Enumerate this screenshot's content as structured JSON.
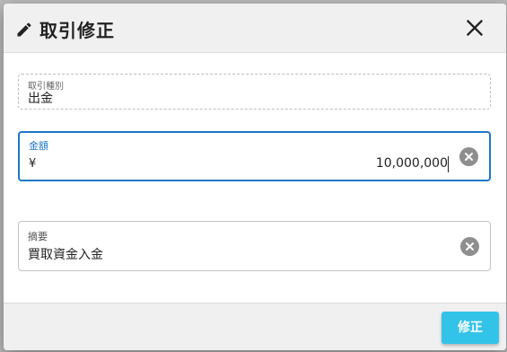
{
  "dialog": {
    "title": "取引修正",
    "title_icon": "pencil-icon",
    "close_icon": "close-icon"
  },
  "fields": {
    "transaction_type": {
      "label": "取引種別",
      "value": "出金"
    },
    "amount": {
      "label": "金額",
      "prefix": "¥",
      "value": "10,000,000"
    },
    "memo": {
      "label": "摘要",
      "value": "買取資金入金"
    }
  },
  "footer": {
    "submit_label": "修正"
  },
  "colors": {
    "accent": "#1e77c7",
    "submit_button": "#33c3e8"
  }
}
